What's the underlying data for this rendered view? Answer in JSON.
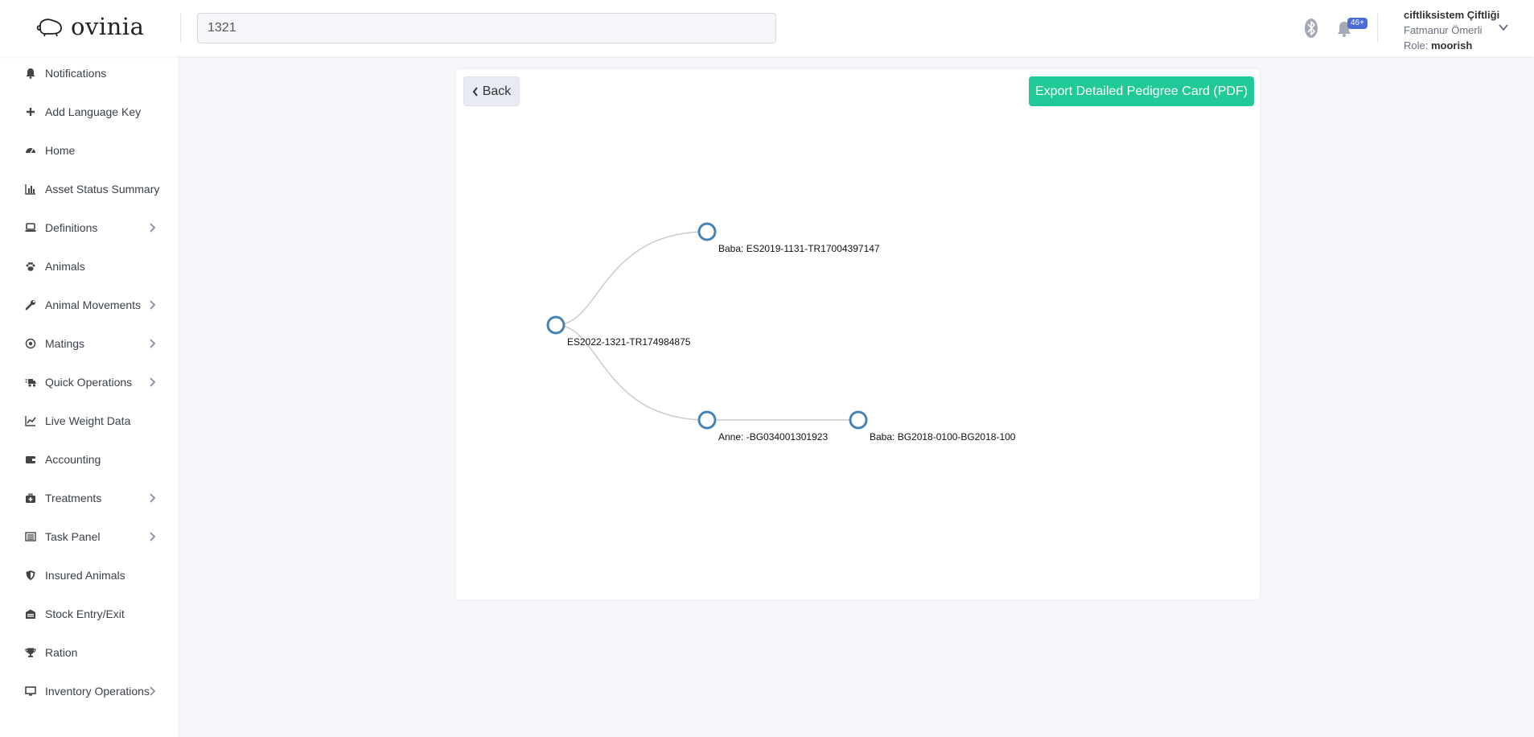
{
  "header": {
    "logo_text": "ovinia",
    "search_value": "1321",
    "notification_badge": "46+",
    "user": {
      "farm": "ciftliksistem Çiftliği",
      "name": "Fatmanur Ömerli",
      "role_label": "Role:",
      "role_value": "moorish"
    }
  },
  "sidebar": {
    "items": [
      {
        "label": "Notifications",
        "icon": "bell-icon",
        "has_submenu": false
      },
      {
        "label": "Add Language Key",
        "icon": "plus-icon",
        "has_submenu": false
      },
      {
        "label": "Home",
        "icon": "dashboard-icon",
        "has_submenu": false
      },
      {
        "label": "Asset Status Summary",
        "icon": "bar-chart-icon",
        "has_submenu": false
      },
      {
        "label": "Definitions",
        "icon": "laptop-icon",
        "has_submenu": true
      },
      {
        "label": "Animals",
        "icon": "paw-icon",
        "has_submenu": false
      },
      {
        "label": "Animal Movements",
        "icon": "wrench-icon",
        "has_submenu": true
      },
      {
        "label": "Matings",
        "icon": "dot-circle-icon",
        "has_submenu": true
      },
      {
        "label": "Quick Operations",
        "icon": "shipping-icon",
        "has_submenu": true
      },
      {
        "label": "Live Weight Data",
        "icon": "line-chart-icon",
        "has_submenu": false
      },
      {
        "label": "Accounting",
        "icon": "wallet-icon",
        "has_submenu": false
      },
      {
        "label": "Treatments",
        "icon": "medkit-icon",
        "has_submenu": true
      },
      {
        "label": "Task Panel",
        "icon": "list-icon",
        "has_submenu": true
      },
      {
        "label": "Insured Animals",
        "icon": "shield-icon",
        "has_submenu": false
      },
      {
        "label": "Stock Entry/Exit",
        "icon": "warehouse-icon",
        "has_submenu": false
      },
      {
        "label": "Ration",
        "icon": "trophy-icon",
        "has_submenu": false
      },
      {
        "label": "Inventory Operations",
        "icon": "monitor-icon",
        "has_submenu": true
      }
    ]
  },
  "main": {
    "back_label": "Back",
    "export_label": "Export Detailed Pedigree Card (PDF)",
    "pedigree": {
      "root": "ES2022-1321-TR174984875",
      "father": "Baba: ES2019-1131-TR17004397147",
      "mother": "Anne: -BG034001301923",
      "mother_father": "Baba: BG2018-0100-BG2018-100"
    }
  },
  "colors": {
    "accent_green": "#20c997",
    "node_stroke": "#4682b4",
    "badge_blue": "#4a6cd6"
  }
}
